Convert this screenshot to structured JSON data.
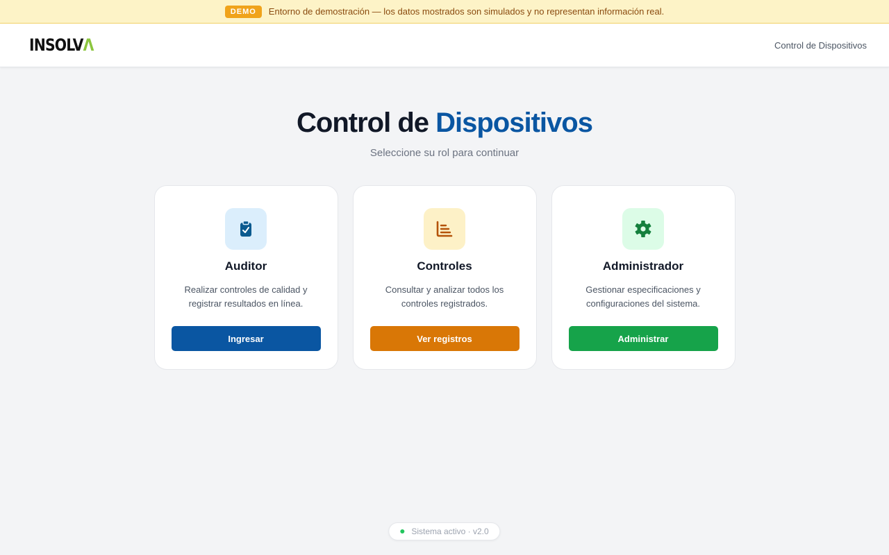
{
  "banner": {
    "badge": "DEMO",
    "text": "Entorno de demostración — los datos mostrados son simulados y no representan información real."
  },
  "header": {
    "logo_main": "INSOLV",
    "logo_accent": "Λ",
    "nav_link": "Control de Dispositivos"
  },
  "hero": {
    "title_part1": "Control de ",
    "title_part2": "Dispositivos",
    "subtitle": "Seleccione su rol para continuar"
  },
  "cards": [
    {
      "title": "Auditor",
      "description": "Realizar controles de calidad y registrar resultados en línea.",
      "button": "Ingresar",
      "icon": "clipboard-check-icon",
      "button_color": "#0a56a2",
      "icon_bg": "#dbeefc",
      "icon_color": "#0b5a8f"
    },
    {
      "title": "Controles",
      "description": "Consultar y analizar todos los controles registrados.",
      "button": "Ver registros",
      "icon": "chart-icon",
      "button_color": "#d97706",
      "icon_bg": "#fdf1c7",
      "icon_color": "#b45309"
    },
    {
      "title": "Administrador",
      "description": "Gestionar especificaciones y configuraciones del sistema.",
      "button": "Administrar",
      "icon": "gear-icon",
      "button_color": "#16a34a",
      "icon_bg": "#dcfce7",
      "icon_color": "#15803d"
    }
  ],
  "footer": {
    "status": "Sistema activo · v2.0"
  }
}
